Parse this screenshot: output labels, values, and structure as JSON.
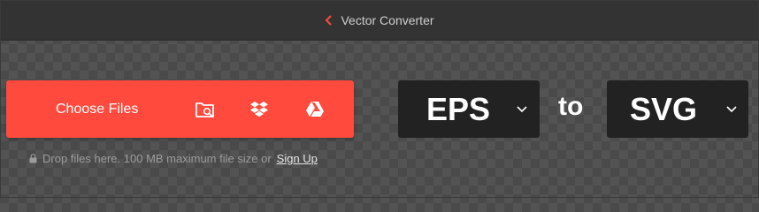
{
  "header": {
    "back_label": "Vector Converter"
  },
  "upload": {
    "choose_label": "Choose Files",
    "sources": [
      "folder-search-icon",
      "dropbox-icon",
      "google-drive-icon"
    ]
  },
  "hint": {
    "text": "Drop files here. 100 MB maximum file size or",
    "signup_link": "Sign Up"
  },
  "conversion": {
    "from_format": "EPS",
    "connector": "to",
    "to_format": "SVG"
  },
  "colors": {
    "accent": "#ff4a3d",
    "background": "#4a4a4a",
    "format_box": "#222222"
  }
}
